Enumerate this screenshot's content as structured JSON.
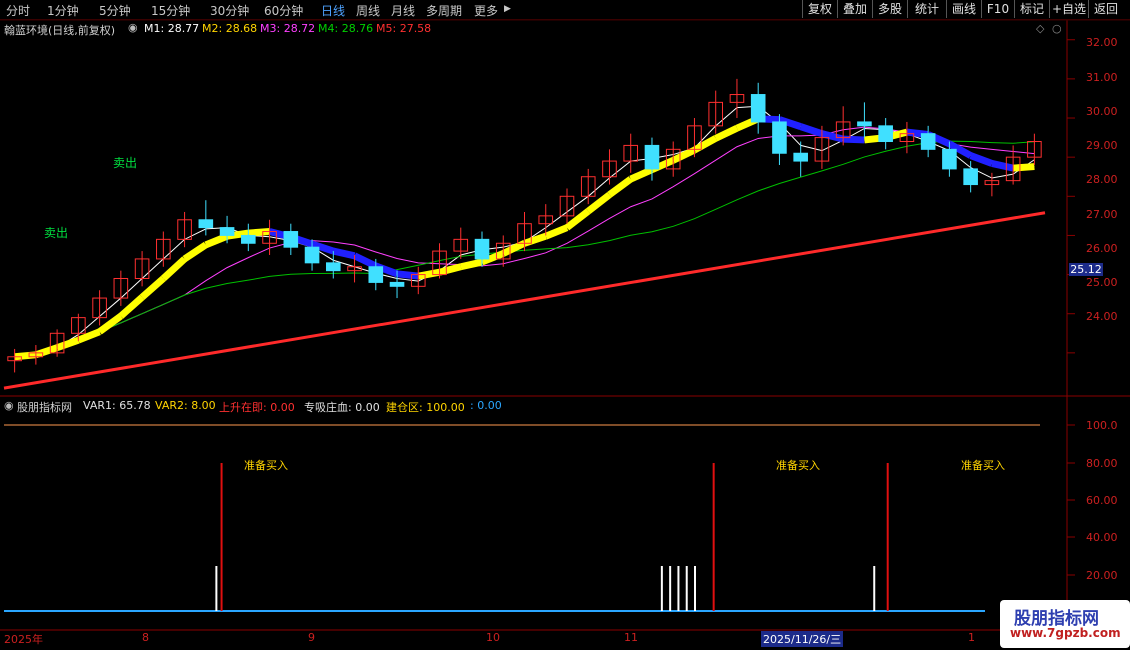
{
  "toolbar": {
    "periods": [
      "分时",
      "1分钟",
      "5分钟",
      "15分钟",
      "30分钟",
      "60分钟",
      "日线",
      "周线",
      "月线",
      "多周期",
      "更多"
    ],
    "active_period": "日线",
    "right_buttons": [
      "复权",
      "叠加",
      "多股",
      "统计",
      "画线",
      "F10",
      "标记",
      "+自选",
      "返回"
    ]
  },
  "main_chart": {
    "title": "翰蓝环境(日线,前复权)",
    "ma": [
      {
        "label": "M1: 28.77",
        "color": "#ffffff"
      },
      {
        "label": "M2: 28.68",
        "color": "#ffd400"
      },
      {
        "label": "M3: 28.72",
        "color": "#ff40ff"
      },
      {
        "label": "M4: 28.76",
        "color": "#00d000"
      },
      {
        "label": "M5: 27.58",
        "color": "#ff3030"
      }
    ],
    "price_labels": [
      "32.00",
      "31.00",
      "30.00",
      "29.00",
      "28.00",
      "27.00",
      "26.00",
      "25.00",
      "24.00"
    ],
    "current_price_tag": "25.12",
    "sell_labels": [
      "卖出",
      "卖出"
    ]
  },
  "indicator": {
    "title": "股朋指标网",
    "items": [
      {
        "label": "VAR1: 65.78",
        "color": "#e0e0e0"
      },
      {
        "label": "VAR2: 8.00",
        "color": "#ffd400"
      },
      {
        "label": "上升在即: 0.00",
        "color": "#ff3030"
      },
      {
        "label": "专吸庄血: 0.00",
        "color": "#e0e0e0"
      },
      {
        "label": "建仓区: 100.00",
        "color": "#ffd400"
      },
      {
        "label": ": 0.00",
        "color": "#2aa6ff"
      }
    ],
    "scale": [
      "100.0",
      "80.00",
      "60.00",
      "40.00",
      "20.00"
    ],
    "signal_label": "准备买入"
  },
  "x_axis": {
    "labels": [
      "2025年",
      "8",
      "9",
      "10",
      "11",
      "1"
    ],
    "cursor_date": "2025/11/26/三"
  },
  "watermark": {
    "title": "股朋指标网",
    "url": "www.7gpzb.com"
  },
  "chart_data": {
    "type": "line",
    "candles_ohlc": [
      [
        23.8,
        24.1,
        23.5,
        23.9
      ],
      [
        23.9,
        24.2,
        23.7,
        24.0
      ],
      [
        24.0,
        24.6,
        23.9,
        24.5
      ],
      [
        24.5,
        25.0,
        24.3,
        24.9
      ],
      [
        24.9,
        25.6,
        24.7,
        25.4
      ],
      [
        25.4,
        26.1,
        25.2,
        25.9
      ],
      [
        25.9,
        26.6,
        25.7,
        26.4
      ],
      [
        26.4,
        27.1,
        26.2,
        26.9
      ],
      [
        26.9,
        27.6,
        26.7,
        27.4
      ],
      [
        27.4,
        27.9,
        27.0,
        27.2
      ],
      [
        27.2,
        27.5,
        26.8,
        27.0
      ],
      [
        27.0,
        27.3,
        26.6,
        26.8
      ],
      [
        26.8,
        27.4,
        26.5,
        27.1
      ],
      [
        27.1,
        27.3,
        26.5,
        26.7
      ],
      [
        26.7,
        26.9,
        26.1,
        26.3
      ],
      [
        26.3,
        26.6,
        25.9,
        26.1
      ],
      [
        26.1,
        26.5,
        25.8,
        26.2
      ],
      [
        26.2,
        26.4,
        25.6,
        25.8
      ],
      [
        25.8,
        26.1,
        25.4,
        25.7
      ],
      [
        25.7,
        26.2,
        25.5,
        26.0
      ],
      [
        26.0,
        26.8,
        25.9,
        26.6
      ],
      [
        26.6,
        27.2,
        26.4,
        26.9
      ],
      [
        26.9,
        27.1,
        26.2,
        26.4
      ],
      [
        26.4,
        27.0,
        26.2,
        26.8
      ],
      [
        26.8,
        27.6,
        26.6,
        27.3
      ],
      [
        27.3,
        27.8,
        27.0,
        27.5
      ],
      [
        27.5,
        28.2,
        27.3,
        28.0
      ],
      [
        28.0,
        28.7,
        27.8,
        28.5
      ],
      [
        28.5,
        29.2,
        28.3,
        28.9
      ],
      [
        28.9,
        29.6,
        28.6,
        29.3
      ],
      [
        29.3,
        29.5,
        28.4,
        28.7
      ],
      [
        28.7,
        29.4,
        28.5,
        29.2
      ],
      [
        29.2,
        30.0,
        29.0,
        29.8
      ],
      [
        29.8,
        30.7,
        29.6,
        30.4
      ],
      [
        30.4,
        31.0,
        30.0,
        30.6
      ],
      [
        30.6,
        30.9,
        29.6,
        29.9
      ],
      [
        29.9,
        30.1,
        28.8,
        29.1
      ],
      [
        29.1,
        29.4,
        28.5,
        28.9
      ],
      [
        28.9,
        29.8,
        28.7,
        29.5
      ],
      [
        29.5,
        30.3,
        29.3,
        29.9
      ],
      [
        29.9,
        30.4,
        29.5,
        29.8
      ],
      [
        29.8,
        30.0,
        29.2,
        29.4
      ],
      [
        29.4,
        29.9,
        29.1,
        29.6
      ],
      [
        29.6,
        29.8,
        29.0,
        29.2
      ],
      [
        29.2,
        29.4,
        28.5,
        28.7
      ],
      [
        28.7,
        28.9,
        28.1,
        28.3
      ],
      [
        28.3,
        28.6,
        28.0,
        28.4
      ],
      [
        28.4,
        29.3,
        28.3,
        29.0
      ],
      [
        29.0,
        29.6,
        28.8,
        29.4
      ]
    ],
    "m5_line": {
      "start": 23.1,
      "end": 27.58
    },
    "signals_pct": [
      0.21,
      0.685,
      0.853
    ],
    "small_bars_pct": [
      0.205,
      0.635,
      0.643,
      0.651,
      0.659,
      0.667,
      0.84
    ],
    "ylim": [
      23.0,
      32.3
    ]
  }
}
